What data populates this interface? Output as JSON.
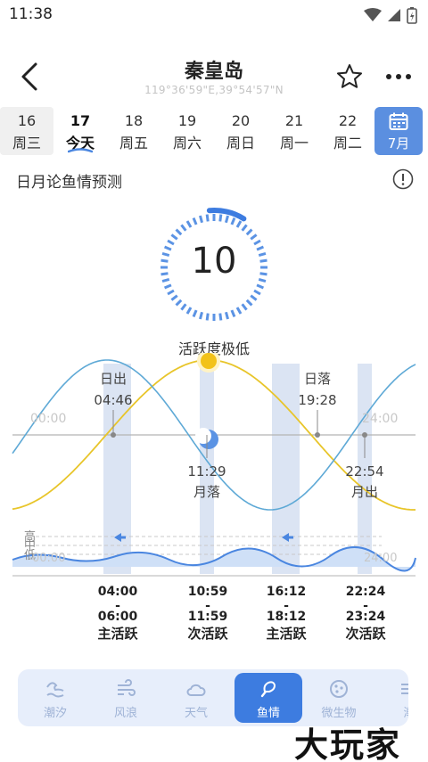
{
  "status_bar": {
    "time": "11:38"
  },
  "header": {
    "title": "秦皇岛",
    "coords": "119°36'59\"E,39°54'57\"N"
  },
  "date_strip": {
    "days": [
      {
        "num": "16",
        "weekday": "周三",
        "state": "past"
      },
      {
        "num": "17",
        "weekday": "今天",
        "state": "today"
      },
      {
        "num": "18",
        "weekday": "周五",
        "state": "future"
      },
      {
        "num": "19",
        "weekday": "周六",
        "state": "future"
      },
      {
        "num": "20",
        "weekday": "周日",
        "state": "future"
      },
      {
        "num": "21",
        "weekday": "周一",
        "state": "future"
      },
      {
        "num": "22",
        "weekday": "周二",
        "state": "future"
      }
    ],
    "calendar_label": "7月"
  },
  "section": {
    "title": "日月论鱼情预测"
  },
  "gauge": {
    "value": "10",
    "max": 100,
    "label": "活跃度极低"
  },
  "chart_data": {
    "type": "line",
    "time_axis": {
      "start": "00:00",
      "end": "24:00"
    },
    "sun": {
      "rise_label": "日出",
      "rise": "04:46",
      "set_label": "日落",
      "set": "19:28"
    },
    "moon": {
      "set_label": "月落",
      "set": "11:29",
      "rise_label": "月出",
      "rise": "22:54"
    },
    "tide_level_labels": [
      "高",
      "中",
      "低"
    ],
    "activity_periods": [
      {
        "range_start": "04:00",
        "range_end": "06:00",
        "label": "主活跃"
      },
      {
        "range_start": "10:59",
        "range_end": "11:59",
        "label": "次活跃"
      },
      {
        "range_start": "16:12",
        "range_end": "18:12",
        "label": "主活跃"
      },
      {
        "range_start": "22:24",
        "range_end": "23:24",
        "label": "次活跃"
      }
    ],
    "colors": {
      "sun_curve": "#e8c52a",
      "moon_curve": "#5ea9d6",
      "period_band": "#dbe4f3",
      "tide": "#4a86e0"
    }
  },
  "tabs": [
    {
      "label": "潮汐",
      "icon": "tide-icon",
      "active": false
    },
    {
      "label": "风浪",
      "icon": "wind-icon",
      "active": false
    },
    {
      "label": "天气",
      "icon": "cloud-icon",
      "active": false
    },
    {
      "label": "鱼情",
      "icon": "fishing-icon",
      "active": true
    },
    {
      "label": "微生物",
      "icon": "microbe-icon",
      "active": false
    },
    {
      "label": "潮",
      "icon": "tide-more-icon",
      "active": false
    }
  ],
  "watermark": "大玩家"
}
